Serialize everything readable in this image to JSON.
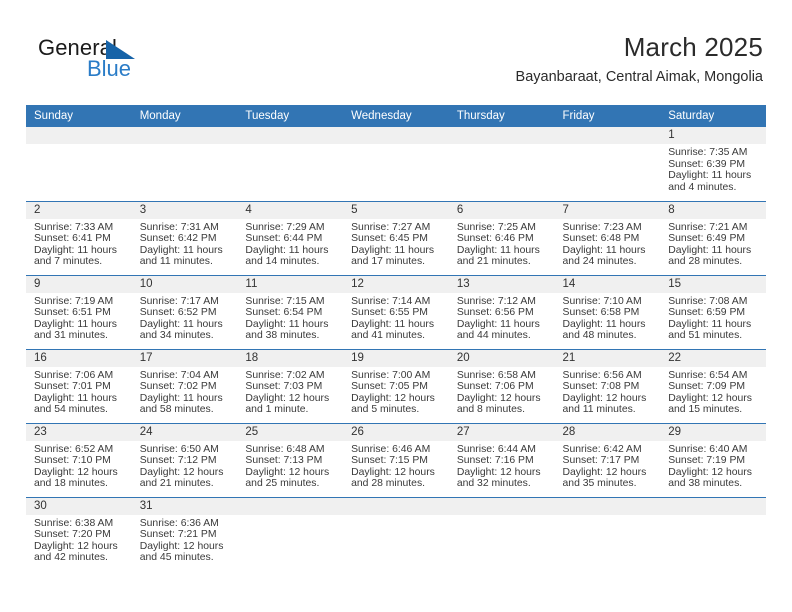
{
  "brand": {
    "word1": "General",
    "word2": "Blue",
    "flag_icon": "blue-flag-triangle-icon",
    "word1_color": "#1b1b1b",
    "word2_color": "#2a7cc7"
  },
  "header": {
    "title": "March 2025",
    "subtitle": "Bayanbaraat, Central Aimak, Mongolia"
  },
  "theme": {
    "header_blue": "#3275B4",
    "daynum_band": "#f0f0f0",
    "row_divider": "#3275B4",
    "text": "#3a3a3a"
  },
  "weekdays": [
    "Sunday",
    "Monday",
    "Tuesday",
    "Wednesday",
    "Thursday",
    "Friday",
    "Saturday"
  ],
  "calendar": {
    "month": "March",
    "year": "2025",
    "weeks": [
      [
        {
          "day": "",
          "empty": true
        },
        {
          "day": "",
          "empty": true
        },
        {
          "day": "",
          "empty": true
        },
        {
          "day": "",
          "empty": true
        },
        {
          "day": "",
          "empty": true
        },
        {
          "day": "",
          "empty": true
        },
        {
          "day": "1",
          "sunrise": "Sunrise: 7:35 AM",
          "sunset": "Sunset: 6:39 PM",
          "daylight_1": "Daylight: 11 hours",
          "daylight_2": "and 4 minutes."
        }
      ],
      [
        {
          "day": "2",
          "sunrise": "Sunrise: 7:33 AM",
          "sunset": "Sunset: 6:41 PM",
          "daylight_1": "Daylight: 11 hours",
          "daylight_2": "and 7 minutes."
        },
        {
          "day": "3",
          "sunrise": "Sunrise: 7:31 AM",
          "sunset": "Sunset: 6:42 PM",
          "daylight_1": "Daylight: 11 hours",
          "daylight_2": "and 11 minutes."
        },
        {
          "day": "4",
          "sunrise": "Sunrise: 7:29 AM",
          "sunset": "Sunset: 6:44 PM",
          "daylight_1": "Daylight: 11 hours",
          "daylight_2": "and 14 minutes."
        },
        {
          "day": "5",
          "sunrise": "Sunrise: 7:27 AM",
          "sunset": "Sunset: 6:45 PM",
          "daylight_1": "Daylight: 11 hours",
          "daylight_2": "and 17 minutes."
        },
        {
          "day": "6",
          "sunrise": "Sunrise: 7:25 AM",
          "sunset": "Sunset: 6:46 PM",
          "daylight_1": "Daylight: 11 hours",
          "daylight_2": "and 21 minutes."
        },
        {
          "day": "7",
          "sunrise": "Sunrise: 7:23 AM",
          "sunset": "Sunset: 6:48 PM",
          "daylight_1": "Daylight: 11 hours",
          "daylight_2": "and 24 minutes."
        },
        {
          "day": "8",
          "sunrise": "Sunrise: 7:21 AM",
          "sunset": "Sunset: 6:49 PM",
          "daylight_1": "Daylight: 11 hours",
          "daylight_2": "and 28 minutes."
        }
      ],
      [
        {
          "day": "9",
          "sunrise": "Sunrise: 7:19 AM",
          "sunset": "Sunset: 6:51 PM",
          "daylight_1": "Daylight: 11 hours",
          "daylight_2": "and 31 minutes."
        },
        {
          "day": "10",
          "sunrise": "Sunrise: 7:17 AM",
          "sunset": "Sunset: 6:52 PM",
          "daylight_1": "Daylight: 11 hours",
          "daylight_2": "and 34 minutes."
        },
        {
          "day": "11",
          "sunrise": "Sunrise: 7:15 AM",
          "sunset": "Sunset: 6:54 PM",
          "daylight_1": "Daylight: 11 hours",
          "daylight_2": "and 38 minutes."
        },
        {
          "day": "12",
          "sunrise": "Sunrise: 7:14 AM",
          "sunset": "Sunset: 6:55 PM",
          "daylight_1": "Daylight: 11 hours",
          "daylight_2": "and 41 minutes."
        },
        {
          "day": "13",
          "sunrise": "Sunrise: 7:12 AM",
          "sunset": "Sunset: 6:56 PM",
          "daylight_1": "Daylight: 11 hours",
          "daylight_2": "and 44 minutes."
        },
        {
          "day": "14",
          "sunrise": "Sunrise: 7:10 AM",
          "sunset": "Sunset: 6:58 PM",
          "daylight_1": "Daylight: 11 hours",
          "daylight_2": "and 48 minutes."
        },
        {
          "day": "15",
          "sunrise": "Sunrise: 7:08 AM",
          "sunset": "Sunset: 6:59 PM",
          "daylight_1": "Daylight: 11 hours",
          "daylight_2": "and 51 minutes."
        }
      ],
      [
        {
          "day": "16",
          "sunrise": "Sunrise: 7:06 AM",
          "sunset": "Sunset: 7:01 PM",
          "daylight_1": "Daylight: 11 hours",
          "daylight_2": "and 54 minutes."
        },
        {
          "day": "17",
          "sunrise": "Sunrise: 7:04 AM",
          "sunset": "Sunset: 7:02 PM",
          "daylight_1": "Daylight: 11 hours",
          "daylight_2": "and 58 minutes."
        },
        {
          "day": "18",
          "sunrise": "Sunrise: 7:02 AM",
          "sunset": "Sunset: 7:03 PM",
          "daylight_1": "Daylight: 12 hours",
          "daylight_2": "and 1 minute."
        },
        {
          "day": "19",
          "sunrise": "Sunrise: 7:00 AM",
          "sunset": "Sunset: 7:05 PM",
          "daylight_1": "Daylight: 12 hours",
          "daylight_2": "and 5 minutes."
        },
        {
          "day": "20",
          "sunrise": "Sunrise: 6:58 AM",
          "sunset": "Sunset: 7:06 PM",
          "daylight_1": "Daylight: 12 hours",
          "daylight_2": "and 8 minutes."
        },
        {
          "day": "21",
          "sunrise": "Sunrise: 6:56 AM",
          "sunset": "Sunset: 7:08 PM",
          "daylight_1": "Daylight: 12 hours",
          "daylight_2": "and 11 minutes."
        },
        {
          "day": "22",
          "sunrise": "Sunrise: 6:54 AM",
          "sunset": "Sunset: 7:09 PM",
          "daylight_1": "Daylight: 12 hours",
          "daylight_2": "and 15 minutes."
        }
      ],
      [
        {
          "day": "23",
          "sunrise": "Sunrise: 6:52 AM",
          "sunset": "Sunset: 7:10 PM",
          "daylight_1": "Daylight: 12 hours",
          "daylight_2": "and 18 minutes."
        },
        {
          "day": "24",
          "sunrise": "Sunrise: 6:50 AM",
          "sunset": "Sunset: 7:12 PM",
          "daylight_1": "Daylight: 12 hours",
          "daylight_2": "and 21 minutes."
        },
        {
          "day": "25",
          "sunrise": "Sunrise: 6:48 AM",
          "sunset": "Sunset: 7:13 PM",
          "daylight_1": "Daylight: 12 hours",
          "daylight_2": "and 25 minutes."
        },
        {
          "day": "26",
          "sunrise": "Sunrise: 6:46 AM",
          "sunset": "Sunset: 7:15 PM",
          "daylight_1": "Daylight: 12 hours",
          "daylight_2": "and 28 minutes."
        },
        {
          "day": "27",
          "sunrise": "Sunrise: 6:44 AM",
          "sunset": "Sunset: 7:16 PM",
          "daylight_1": "Daylight: 12 hours",
          "daylight_2": "and 32 minutes."
        },
        {
          "day": "28",
          "sunrise": "Sunrise: 6:42 AM",
          "sunset": "Sunset: 7:17 PM",
          "daylight_1": "Daylight: 12 hours",
          "daylight_2": "and 35 minutes."
        },
        {
          "day": "29",
          "sunrise": "Sunrise: 6:40 AM",
          "sunset": "Sunset: 7:19 PM",
          "daylight_1": "Daylight: 12 hours",
          "daylight_2": "and 38 minutes."
        }
      ],
      [
        {
          "day": "30",
          "sunrise": "Sunrise: 6:38 AM",
          "sunset": "Sunset: 7:20 PM",
          "daylight_1": "Daylight: 12 hours",
          "daylight_2": "and 42 minutes."
        },
        {
          "day": "31",
          "sunrise": "Sunrise: 6:36 AM",
          "sunset": "Sunset: 7:21 PM",
          "daylight_1": "Daylight: 12 hours",
          "daylight_2": "and 45 minutes."
        },
        {
          "day": "",
          "empty": true
        },
        {
          "day": "",
          "empty": true
        },
        {
          "day": "",
          "empty": true
        },
        {
          "day": "",
          "empty": true
        },
        {
          "day": "",
          "empty": true
        }
      ]
    ]
  }
}
